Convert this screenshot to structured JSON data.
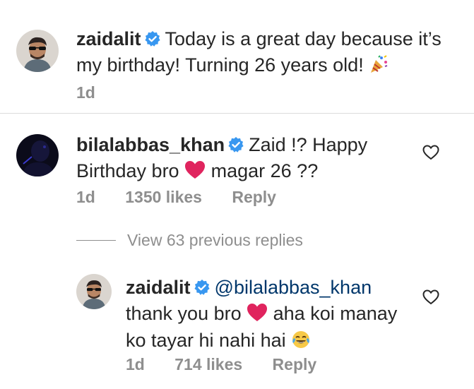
{
  "post": {
    "username": "zaidalit",
    "text": "Today is a great day because it’s my birthday! Turning 26 years old!",
    "time": "1d"
  },
  "comment": {
    "username": "bilalabbas_khan",
    "text_a": "Zaid !? Happy",
    "text_b": "Birthday bro",
    "text_c": "magar 26 ??",
    "time": "1d",
    "likes": "1350 likes",
    "reply_label": "Reply"
  },
  "view_replies": "View 63 previous replies",
  "reply": {
    "username": "zaidalit",
    "mention": "@bilalabbas_khan",
    "text_a": "thank you bro",
    "text_b": "aha koi manay",
    "text_c": "ko tayar hi nahi hai",
    "time": "1d",
    "likes": "714 likes",
    "reply_label": "Reply"
  },
  "colors": {
    "verified": "#3897f0",
    "heart_emoji": "#e0245e",
    "meta": "#8e8e8e",
    "mention": "#00376b"
  },
  "icons": [
    "verified-badge-icon",
    "party-popper-icon",
    "red-heart-icon",
    "tears-of-joy-icon",
    "like-heart-icon"
  ]
}
